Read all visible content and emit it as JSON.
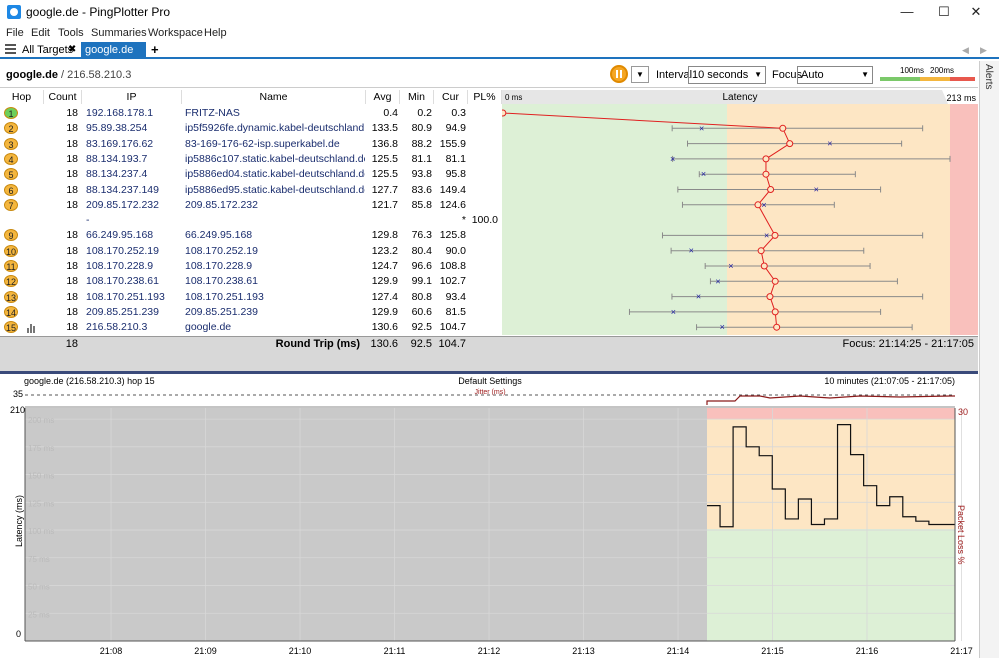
{
  "window": {
    "title": "google.de - PingPlotter Pro",
    "min": "—",
    "max": "☐",
    "close": "✕"
  },
  "menu": [
    "File",
    "Edit",
    "Tools",
    "Summaries",
    "Workspace",
    "Help"
  ],
  "tabs": {
    "all_targets": "All Targets",
    "close": "✖",
    "active": "google.de",
    "check": "✔",
    "add": "+"
  },
  "target": {
    "name": "google.de",
    "ip": " / 216.58.210.3",
    "interval_label": "Interval",
    "interval_value": "10 seconds",
    "focus_label": "Focus",
    "focus_value": "Auto",
    "legend_100": "100ms",
    "legend_200": "200ms"
  },
  "alerts_label": "Alerts",
  "table": {
    "headers": {
      "hop": "Hop",
      "count": "Count",
      "ip": "IP",
      "name": "Name",
      "avg": "Avg",
      "min": "Min",
      "cur": "Cur",
      "pl": "PL%",
      "zero": "0 ms",
      "latency": "Latency",
      "max": "213 ms"
    },
    "rows": [
      {
        "hop": "1",
        "count": "18",
        "ip": "192.168.178.1",
        "name": "FRITZ-NAS",
        "avg": "0.4",
        "min": "0.2",
        "cur": "0.3",
        "pl": "",
        "color": "#6ccf5a"
      },
      {
        "hop": "2",
        "count": "18",
        "ip": "95.89.38.254",
        "name": "ip5f5926fe.dynamic.kabel-deutschland.de",
        "avg": "133.5",
        "min": "80.9",
        "cur": "94.9",
        "pl": "",
        "color": "#f4b63e"
      },
      {
        "hop": "3",
        "count": "18",
        "ip": "83.169.176.62",
        "name": "83-169-176-62-isp.superkabel.de",
        "avg": "136.8",
        "min": "88.2",
        "cur": "155.9",
        "pl": "",
        "color": "#f4b63e"
      },
      {
        "hop": "4",
        "count": "18",
        "ip": "88.134.193.7",
        "name": "ip5886c107.static.kabel-deutschland.de",
        "avg": "125.5",
        "min": "81.1",
        "cur": "81.1",
        "pl": "",
        "color": "#f4b63e"
      },
      {
        "hop": "5",
        "count": "18",
        "ip": "88.134.237.4",
        "name": "ip5886ed04.static.kabel-deutschland.de",
        "avg": "125.5",
        "min": "93.8",
        "cur": "95.8",
        "pl": "",
        "color": "#f4b63e"
      },
      {
        "hop": "6",
        "count": "18",
        "ip": "88.134.237.149",
        "name": "ip5886ed95.static.kabel-deutschland.de",
        "avg": "127.7",
        "min": "83.6",
        "cur": "149.4",
        "pl": "",
        "color": "#f4b63e"
      },
      {
        "hop": "7",
        "count": "18",
        "ip": "209.85.172.232",
        "name": "209.85.172.232",
        "avg": "121.7",
        "min": "85.8",
        "cur": "124.6",
        "pl": "",
        "color": "#f4b63e"
      },
      {
        "hop": "",
        "count": "",
        "ip": "-",
        "name": "",
        "avg": "",
        "min": "",
        "cur": "*",
        "pl": "100.0",
        "color": ""
      },
      {
        "hop": "9",
        "count": "18",
        "ip": "66.249.95.168",
        "name": "66.249.95.168",
        "avg": "129.8",
        "min": "76.3",
        "cur": "125.8",
        "pl": "",
        "color": "#f4b63e"
      },
      {
        "hop": "10",
        "count": "18",
        "ip": "108.170.252.19",
        "name": "108.170.252.19",
        "avg": "123.2",
        "min": "80.4",
        "cur": "90.0",
        "pl": "",
        "color": "#f4b63e"
      },
      {
        "hop": "11",
        "count": "18",
        "ip": "108.170.228.9",
        "name": "108.170.228.9",
        "avg": "124.7",
        "min": "96.6",
        "cur": "108.8",
        "pl": "",
        "color": "#f4b63e"
      },
      {
        "hop": "12",
        "count": "18",
        "ip": "108.170.238.61",
        "name": "108.170.238.61",
        "avg": "129.9",
        "min": "99.1",
        "cur": "102.7",
        "pl": "",
        "color": "#f4b63e"
      },
      {
        "hop": "13",
        "count": "18",
        "ip": "108.170.251.193",
        "name": "108.170.251.193",
        "avg": "127.4",
        "min": "80.8",
        "cur": "93.4",
        "pl": "",
        "color": "#f4b63e"
      },
      {
        "hop": "14",
        "count": "18",
        "ip": "209.85.251.239",
        "name": "209.85.251.239",
        "avg": "129.9",
        "min": "60.6",
        "cur": "81.5",
        "pl": "",
        "color": "#f4b63e"
      },
      {
        "hop": "15",
        "count": "18",
        "ip": "216.58.210.3",
        "name": "google.de",
        "avg": "130.6",
        "min": "92.5",
        "cur": "104.7",
        "pl": "",
        "color": "#f4b63e"
      }
    ],
    "summary": {
      "count": "18",
      "label": "Round Trip (ms)",
      "avg": "130.6",
      "min": "92.5",
      "cur": "104.7",
      "focus": "Focus: 21:14:25 - 21:17:05"
    }
  },
  "timeline": {
    "header_left": "google.de (216.58.210.3) hop 15",
    "header_center": "Default Settings",
    "header_right": "10 minutes (21:07:05 - 21:17:05)",
    "jitter_label": "Jitter (ms)",
    "jitter_max": "35",
    "lat_max": "210",
    "pl_max": "30",
    "ylabel": "Latency (ms)",
    "y2label": "Packet Loss %",
    "zero": "0"
  },
  "chart_data": [
    {
      "type": "line",
      "title": "Latency",
      "xlabel": "",
      "ylabel": "",
      "xlim": [
        0,
        213
      ],
      "hops": [
        "1",
        "2",
        "3",
        "4",
        "5",
        "6",
        "7",
        "9",
        "10",
        "11",
        "12",
        "13",
        "14",
        "15"
      ],
      "avg": [
        0.4,
        133.5,
        136.8,
        125.5,
        125.5,
        127.7,
        121.7,
        129.8,
        123.2,
        124.7,
        129.9,
        127.4,
        129.9,
        130.6
      ],
      "min": [
        0.2,
        80.9,
        88.2,
        81.1,
        93.8,
        83.6,
        85.8,
        76.3,
        80.4,
        96.6,
        99.1,
        80.8,
        60.6,
        92.5
      ],
      "cur": [
        0.3,
        94.9,
        155.9,
        81.1,
        95.8,
        149.4,
        124.6,
        125.8,
        90.0,
        108.8,
        102.7,
        93.4,
        81.5,
        104.7
      ],
      "max": [
        0.6,
        200,
        190,
        213,
        168,
        180,
        158,
        200,
        172,
        175,
        188,
        200,
        180,
        195
      ],
      "zones": {
        "green_until": 100,
        "yellow_until": 200
      }
    },
    {
      "type": "line",
      "title": "",
      "xlabel": "",
      "ylabel": "Latency (ms)",
      "ylim": [
        0,
        210
      ],
      "x": [
        "21:08",
        "21:09",
        "21:10",
        "21:11",
        "21:12",
        "21:13",
        "21:14",
        "21:15",
        "21:16",
        "21:17"
      ],
      "yticks": [
        "200 ms",
        "175 ms",
        "150 ms",
        "125 ms",
        "100 ms",
        "75 ms",
        "50 ms",
        "25 ms"
      ],
      "series": [
        {
          "values": [
            122,
            103,
            193,
            175,
            167,
            137,
            110,
            128,
            105,
            110,
            195,
            168,
            140,
            122,
            130,
            112,
            108,
            105,
            105
          ]
        }
      ]
    }
  ]
}
